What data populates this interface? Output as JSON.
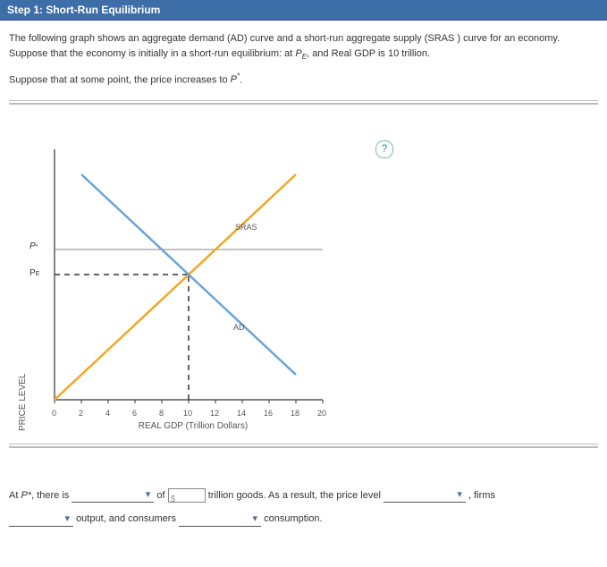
{
  "header": {
    "step_title": "Step 1: Short-Run Equilibrium"
  },
  "intro": {
    "p1_a": "The following graph shows an aggregate demand (AD) curve and a short-run aggregate supply (SRAS ) curve for an economy. Suppose that the economy is initially in a short-run equilibrium: at ",
    "p1_pe": "P",
    "p1_pe_sub": "E",
    "p1_b": ", and Real GDP is 10 trillion.",
    "p2_a": "Suppose that at some point, the price increases to ",
    "p2_pstar": "P",
    "p2_pstar_sup": "*",
    "p2_b": "."
  },
  "help": {
    "symbol": "?"
  },
  "chart_data": {
    "type": "line",
    "xlabel": "REAL GDP (Trillion Dollars)",
    "ylabel": "PRICE LEVEL",
    "xlim": [
      0,
      20
    ],
    "ylim": [
      0,
      10
    ],
    "x_ticks": [
      0,
      2,
      4,
      6,
      8,
      10,
      12,
      14,
      16,
      18,
      20
    ],
    "y_named_ticks": [
      {
        "label": "P*",
        "y": 6
      },
      {
        "label": "PE",
        "y": 5
      }
    ],
    "series": [
      {
        "name": "SRAS",
        "color": "#f5a623",
        "x": [
          0,
          18
        ],
        "y": [
          0,
          9
        ],
        "label_at": {
          "x": 13.2,
          "y": 6.7
        }
      },
      {
        "name": "AD",
        "color": "#6aa3d8",
        "x": [
          2,
          18
        ],
        "y": [
          9,
          1
        ],
        "label_at": {
          "x": 13.2,
          "y": 3.0
        }
      }
    ],
    "guide_lines": [
      {
        "type": "h",
        "y": 6,
        "x_from": 0,
        "x_to": 20,
        "style": "solid",
        "color": "#888"
      },
      {
        "type": "h",
        "y": 5,
        "x_from": 0,
        "x_to": 10,
        "style": "dash",
        "color": "#333"
      },
      {
        "type": "v",
        "x": 10,
        "y_from": 0,
        "y_to": 5,
        "style": "dash",
        "color": "#333"
      }
    ],
    "labels": {
      "sras": "SRAS",
      "ad": "AD"
    }
  },
  "fill": {
    "prefix": "At ",
    "pstar": "P",
    "pstar_sup": "*",
    "after_pstar": ", there is ",
    "of": " of ",
    "input_placeholder": "$",
    "goods": " trillion goods. As a result, the price level ",
    "comma_firms": " , firms ",
    "outputcons": " output, and consumers ",
    "consumption": " consumption."
  }
}
